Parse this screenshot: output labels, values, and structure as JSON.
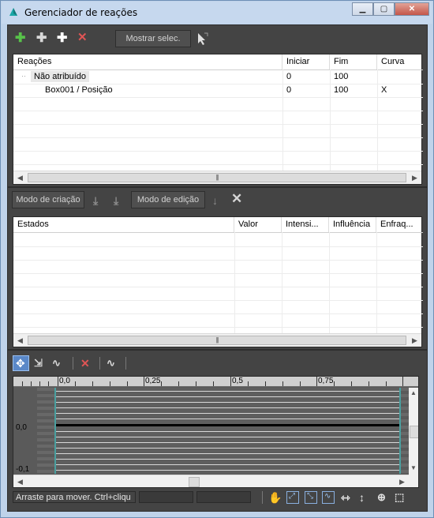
{
  "window": {
    "title": "Gerenciador de reações"
  },
  "toolbar_top": {
    "show_selected_label": "Mostrar selec."
  },
  "reactions_table": {
    "columns": [
      "Reações",
      "Iniciar",
      "Fim",
      "Curva"
    ],
    "rows": [
      {
        "name": "Não atribuído",
        "start": "0",
        "end": "100",
        "curve": ""
      },
      {
        "name": "Box001 / Posição",
        "start": "0",
        "end": "100",
        "curve": "X"
      }
    ]
  },
  "toolbar_mid": {
    "create_mode_label": "Modo de criação",
    "edit_mode_label": "Modo de edição"
  },
  "states_table": {
    "columns": [
      "Estados",
      "Valor",
      "Intensi...",
      "Influência",
      "Enfraq..."
    ]
  },
  "curve_editor": {
    "x_ticks": [
      "0,0",
      "0,25",
      "0,5",
      "0,75"
    ],
    "y_ticks": [
      "0,0",
      "-0,1"
    ]
  },
  "status": {
    "hint": "Arraste para mover. Ctrl+cliqu"
  }
}
